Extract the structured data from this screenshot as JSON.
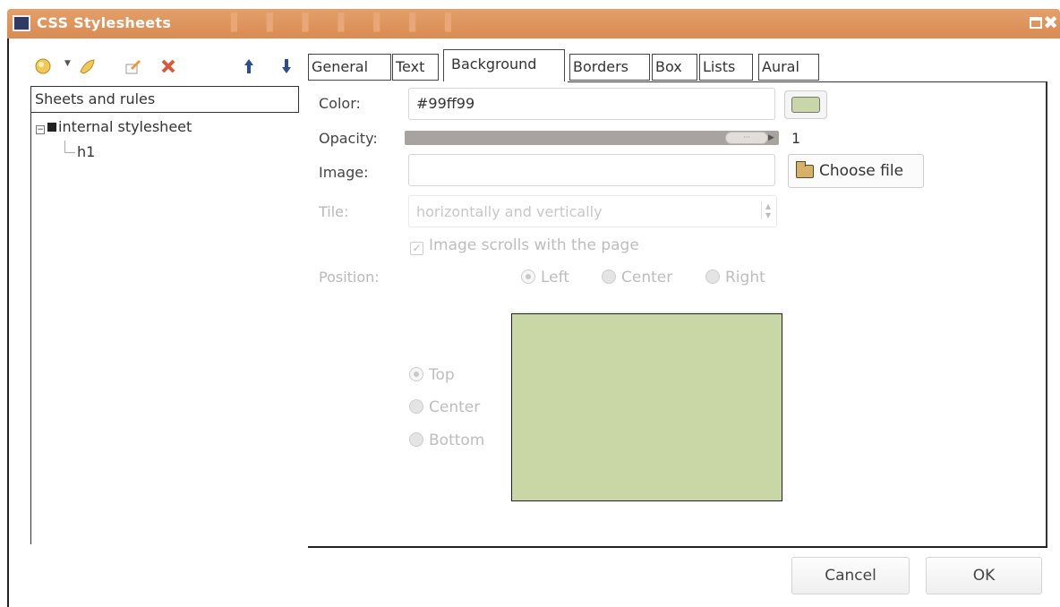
{
  "window": {
    "title": "CSS Stylesheets"
  },
  "toolbar": {
    "buttons": [
      "new-sheet-icon",
      "new-rule-icon",
      "edit-icon",
      "delete-icon",
      "move-up-icon",
      "move-down-icon"
    ]
  },
  "tree": {
    "header": "Sheets and rules",
    "root": "internal stylesheet",
    "child": "h1"
  },
  "tabs": [
    {
      "label": "General"
    },
    {
      "label": "Text"
    },
    {
      "label": "Background",
      "active": true
    },
    {
      "label": "Borders"
    },
    {
      "label": "Box"
    },
    {
      "label": "Lists"
    },
    {
      "label": "Aural"
    }
  ],
  "form": {
    "color_label": "Color:",
    "color_value": "#99ff99",
    "opacity_label": "Opacity:",
    "opacity_value": "1",
    "image_label": "Image:",
    "image_value": "",
    "choose_file": "Choose file",
    "tile_label": "Tile:",
    "tile_value": "horizontally and vertically",
    "scrolls_label": "Image scrolls with the page",
    "position_label": "Position:",
    "h_positions": [
      "Left",
      "Center",
      "Right"
    ],
    "v_positions": [
      "Top",
      "Center",
      "Bottom"
    ]
  },
  "colors": {
    "preview": "#c9d6a6",
    "titlebar": "#d98b52"
  },
  "buttons": {
    "cancel": "Cancel",
    "ok": "OK"
  }
}
